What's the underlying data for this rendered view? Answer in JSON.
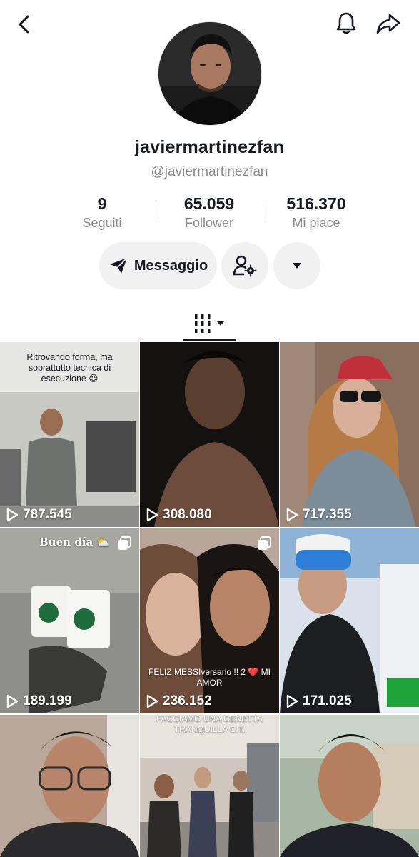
{
  "profile": {
    "username": "javiermartinezfan",
    "handle": "@javiermartinezfan"
  },
  "stats": [
    {
      "value": "9",
      "label": "Seguiti"
    },
    {
      "value": "65.059",
      "label": "Follower"
    },
    {
      "value": "516.370",
      "label": "Mi piace"
    }
  ],
  "actions": {
    "message_label": "Messaggio"
  },
  "icons": {
    "back": "chevron-left-icon",
    "notifications": "bell-icon",
    "share": "share-icon",
    "message": "paper-plane-icon",
    "add_friend": "user-settings-icon",
    "more": "caret-down-icon",
    "grid_tab": "grid-bars-icon",
    "play": "play-icon"
  },
  "videos": [
    {
      "views": "787.545",
      "caption": "Ritrovando forma, ma soprattutto tecnica di esecuzione 😉"
    },
    {
      "views": "308.080",
      "caption": ""
    },
    {
      "views": "717.355",
      "caption": ""
    },
    {
      "views": "189.199",
      "caption": "Buen día ⛅"
    },
    {
      "views": "236.152",
      "caption": "FELIZ MESSIversario !! 2 ❤️ MI AMOR"
    },
    {
      "views": "171.025",
      "caption": ""
    },
    {
      "views": "",
      "caption": ""
    },
    {
      "views": "",
      "caption": "FACCIAMO UNA CENETTA TRANQUILLA CIT."
    },
    {
      "views": "",
      "caption": ""
    }
  ],
  "colors": {
    "text": "#161823",
    "secondary": "#8a8b91",
    "button_bg": "#f1f1f2"
  }
}
